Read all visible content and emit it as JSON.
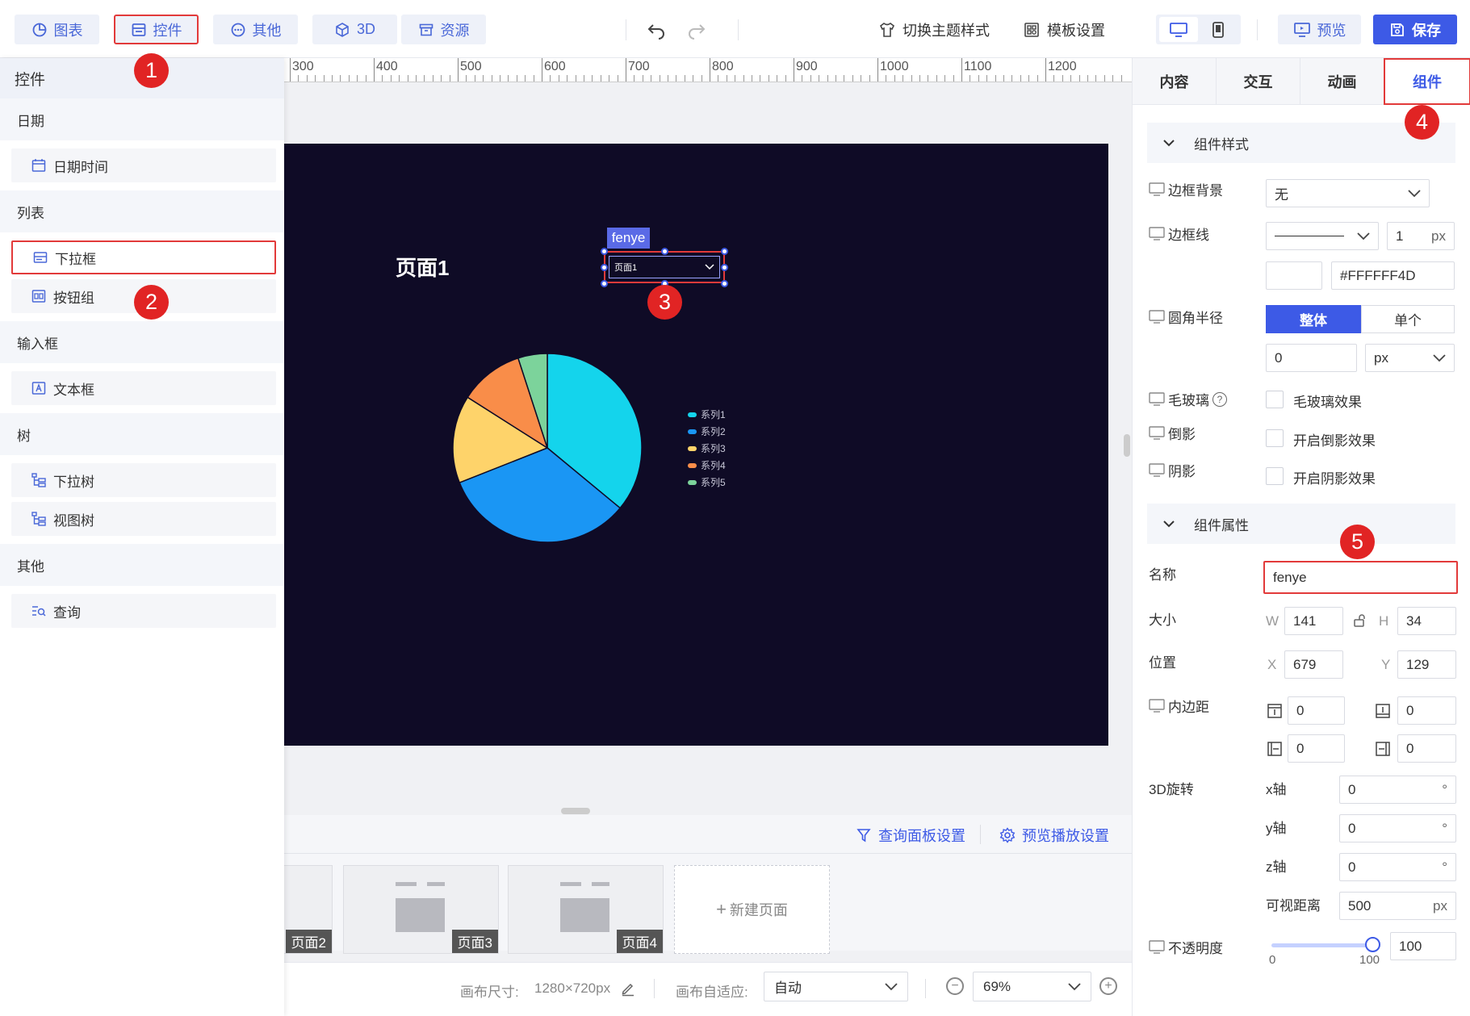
{
  "toolbar": {
    "tabs": [
      {
        "label": "图表",
        "icon": "pie-chart-icon"
      },
      {
        "label": "控件",
        "icon": "widget-icon"
      },
      {
        "label": "其他",
        "icon": "more-icon"
      },
      {
        "label": "3D",
        "icon": "cube-icon"
      },
      {
        "label": "资源",
        "icon": "archive-icon"
      }
    ],
    "theme_label": "切换主题样式",
    "template_label": "模板设置",
    "preview_label": "预览",
    "save_label": "保存"
  },
  "left_panel": {
    "title": "控件",
    "categories": [
      {
        "name": "日期",
        "items": [
          "日期时间"
        ]
      },
      {
        "name": "列表",
        "items": [
          "下拉框",
          "按钮组"
        ]
      },
      {
        "name": "输入框",
        "items": [
          "文本框"
        ]
      },
      {
        "name": "树",
        "items": [
          "下拉树",
          "视图树"
        ]
      },
      {
        "name": "其他",
        "items": [
          "查询"
        ]
      }
    ]
  },
  "ruler": {
    "labels": [
      "300",
      "400",
      "500",
      "600",
      "700",
      "800",
      "900",
      "1000",
      "1100",
      "1200"
    ]
  },
  "canvas": {
    "page_title": "页面1",
    "selected_name": "fenye",
    "dropdown_value": "页面1",
    "legend": [
      "系列1",
      "系列2",
      "系列3",
      "系列4",
      "系列5"
    ]
  },
  "chart_data": {
    "type": "pie",
    "categories": [
      "系列1",
      "系列2",
      "系列3",
      "系列4",
      "系列5"
    ],
    "values": [
      36,
      33,
      15,
      11,
      5
    ],
    "colors": [
      "#14d4ec",
      "#1a96f4",
      "#fed36a",
      "#f98d49",
      "#7cd39b"
    ]
  },
  "bottom": {
    "query_panel_label": "查询面板设置",
    "preview_play_label": "预览播放设置",
    "pages": [
      "页面2",
      "页面3",
      "页面4"
    ],
    "new_page_label": "新建页面",
    "canvas_size_label": "画布尺寸:",
    "canvas_size_value": "1280×720px",
    "auto_fit_label": "画布自适应:",
    "auto_fit_value": "自动",
    "zoom": "69%"
  },
  "right_panel": {
    "tabs": [
      "内容",
      "交互",
      "动画",
      "组件"
    ],
    "style_section": "组件样式",
    "border_bg_label": "边框背景",
    "border_bg_value": "无",
    "border_line_label": "边框线",
    "border_width": "1",
    "unit_px": "px",
    "border_color": "#FFFFFF4D",
    "radius_label": "圆角半径",
    "radius_whole": "整体",
    "radius_single": "单个",
    "radius_value": "0",
    "glass_label": "毛玻璃",
    "glass_check": "毛玻璃效果",
    "reflection_label": "倒影",
    "reflection_check": "开启倒影效果",
    "shadow_label": "阴影",
    "shadow_check": "开启阴影效果",
    "props_section": "组件属性",
    "name_label": "名称",
    "name_value": "fenye",
    "size_label": "大小",
    "w_label": "W",
    "w_value": "141",
    "h_label": "H",
    "h_value": "34",
    "pos_label": "位置",
    "x_label": "X",
    "x_value": "679",
    "y_label": "Y",
    "y_value": "129",
    "padding_label": "内边距",
    "padding_top": "0",
    "padding_bottom": "0",
    "padding_left": "0",
    "padding_right": "0",
    "rotate_label": "3D旋转",
    "x_axis_label": "x轴",
    "x_axis_value": "0",
    "y_axis_label": "y轴",
    "y_axis_value": "0",
    "z_axis_label": "z轴",
    "z_axis_value": "0",
    "degree": "°",
    "view_distance_label": "可视距离",
    "view_distance_value": "500",
    "opacity_label": "不透明度",
    "opacity_min": "0",
    "opacity_max": "100",
    "opacity_value": "100"
  },
  "callouts": [
    "1",
    "2",
    "3",
    "4",
    "5"
  ]
}
